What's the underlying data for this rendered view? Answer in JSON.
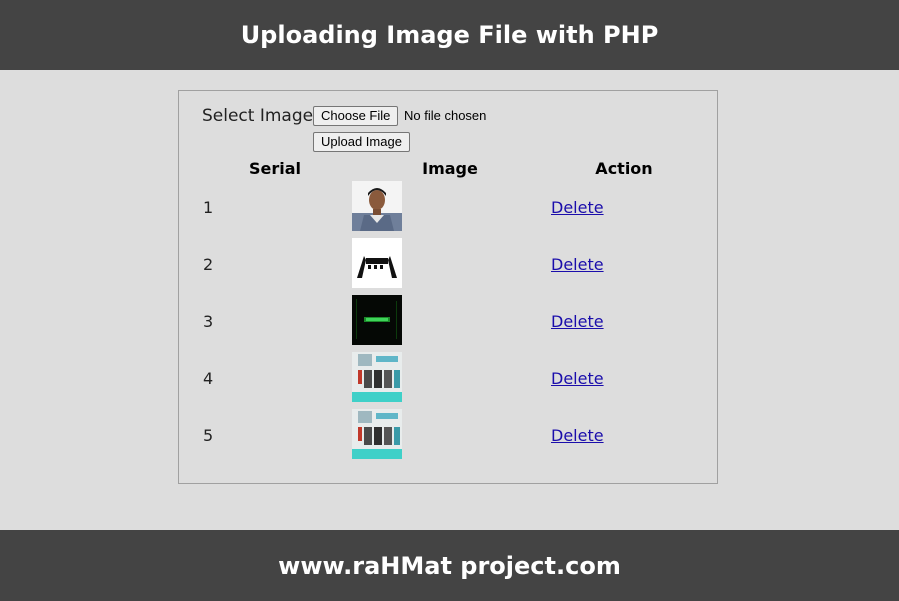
{
  "header": {
    "title": "Uploading Image File with PHP"
  },
  "form": {
    "select_label": "Select Image",
    "choose_file_label": "Choose File",
    "file_status": "No file chosen",
    "upload_label": "Upload Image"
  },
  "table": {
    "headers": {
      "serial": "Serial",
      "image": "Image",
      "action": "Action"
    },
    "rows": [
      {
        "serial": "1",
        "action": "Delete"
      },
      {
        "serial": "2",
        "action": "Delete"
      },
      {
        "serial": "3",
        "action": "Delete"
      },
      {
        "serial": "4",
        "action": "Delete"
      },
      {
        "serial": "5",
        "action": "Delete"
      }
    ]
  },
  "footer": {
    "text": "www.raHMat project.com"
  },
  "colors": {
    "bar": "#444444",
    "background": "#dddddd",
    "link": "#1a0dab"
  }
}
